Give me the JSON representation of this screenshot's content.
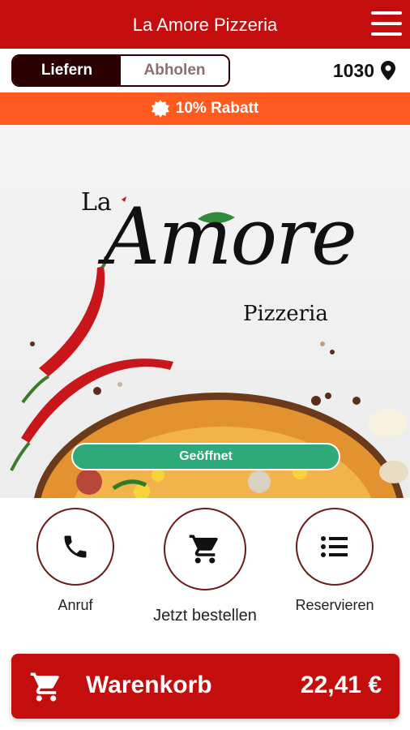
{
  "header": {
    "title": "La Amore Pizzeria",
    "menu_icon": "hamburger-menu-icon"
  },
  "mode": {
    "deliver": "Liefern",
    "pickup": "Abholen",
    "selected": "Liefern"
  },
  "location": {
    "postal_code": "1030",
    "icon": "location-pin-icon"
  },
  "promo": {
    "text": "10% Rabatt",
    "icon": "badge-icon",
    "color": "#ff5a1f"
  },
  "hero": {
    "logo": {
      "la": "La",
      "amore": "Amore",
      "pizzeria": "Pizzeria"
    },
    "status": "Geöffnet",
    "status_color": "#2ea97a"
  },
  "actions": [
    {
      "label": "Anruf",
      "icon": "phone-icon"
    },
    {
      "label": "Jetzt bestellen",
      "icon": "cart-icon"
    },
    {
      "label": "Reservieren",
      "icon": "list-icon"
    }
  ],
  "cart": {
    "label": "Warenkorb",
    "total": "22,41 €",
    "icon": "cart-icon"
  },
  "colors": {
    "brand": "#c40e0e",
    "dark": "#2a0000"
  }
}
